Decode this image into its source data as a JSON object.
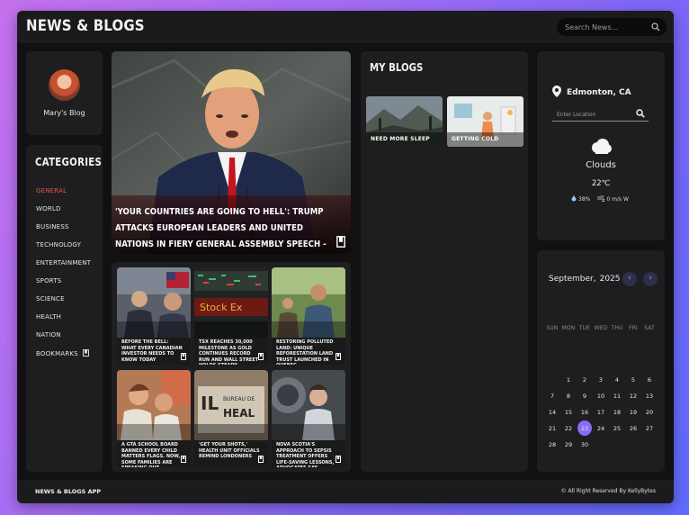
{
  "header": {
    "logo": "NEWS & BLOGS",
    "search_placeholder": "Search News..."
  },
  "profile": {
    "name": "Mary's Blog"
  },
  "categories": {
    "title": "CATEGORIES",
    "items": [
      {
        "label": "GENERAL",
        "active": true
      },
      {
        "label": "WORLD"
      },
      {
        "label": "BUSINESS"
      },
      {
        "label": "TECHNOLOGY"
      },
      {
        "label": "ENTERTAINMENT"
      },
      {
        "label": "SPORTS"
      },
      {
        "label": "SCIENCE"
      },
      {
        "label": "HEALTH"
      },
      {
        "label": "NATION"
      },
      {
        "label": "BOOKMARKS"
      }
    ]
  },
  "headline": {
    "title": "'YOUR COUNTRIES ARE GOING TO HELL': TRUMP ATTACKS EUROPEAN LEADERS AND UNITED NATIONS IN FIERY GENERAL ASSEMBLY SPEECH - LIVE"
  },
  "news_cards": [
    {
      "title": "Before the bell: What every Canadian investor needs to know today"
    },
    {
      "title": "TSX reaches 30,000 milestone as gold continues record run and Wall Street holds steady"
    },
    {
      "title": "Restoring polluted land: Unique reforestation land trust launched in Quebec"
    },
    {
      "title": "A GTA school board banned every child matters flags. Now, some families are speaking out"
    },
    {
      "title": "'Get your shots,' health unit officials remind Londoners"
    },
    {
      "title": "Nova Scotia's approach to sepsis treatment offers life-saving lessons, advocates say"
    }
  ],
  "my_blogs": {
    "title": "MY BLOGS",
    "items": [
      {
        "label": "NEED MORE SLEEP"
      },
      {
        "label": "GETTING COLD"
      }
    ]
  },
  "weather": {
    "city": "Edmonton, CA",
    "location_placeholder": "Enter Location",
    "condition": "Clouds",
    "temperature": "22℃",
    "humidity": "38%",
    "wind": "0 m/s W"
  },
  "calendar": {
    "month": "September,",
    "year": "2025",
    "prev": "‹",
    "next": "›",
    "weekdays": [
      "SUN",
      "MON",
      "TUE",
      "WED",
      "THU",
      "FRI",
      "SAT"
    ],
    "today": "23",
    "weeks": [
      [
        "",
        "1",
        "2",
        "3",
        "4",
        "5",
        "6"
      ],
      [
        "7",
        "8",
        "9",
        "10",
        "11",
        "12",
        "13"
      ],
      [
        "14",
        "15",
        "16",
        "17",
        "18",
        "19",
        "20"
      ],
      [
        "21",
        "22",
        "23",
        "24",
        "25",
        "26",
        "27"
      ],
      [
        "28",
        "29",
        "30",
        "",
        "",
        "",
        ""
      ]
    ]
  },
  "footer": {
    "left": "NEWS & BLOGS APP",
    "right": "© All Right Reserved By KellyBytes"
  },
  "colors": {
    "accent_active": "#e8524d",
    "today_highlight": "#8a6cf7",
    "panel": "#1e1e20",
    "background": "#111113"
  }
}
